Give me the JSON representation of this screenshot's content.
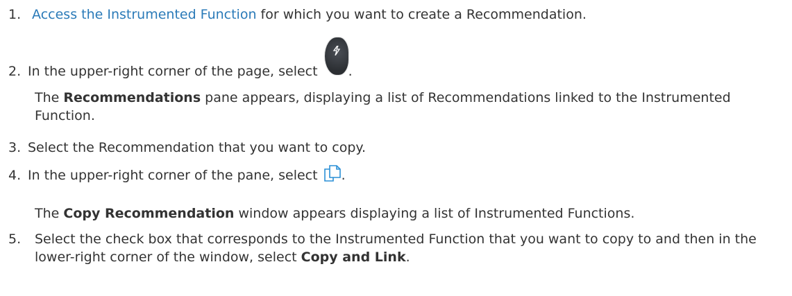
{
  "steps": [
    {
      "number": "1.",
      "link_text": "Access the Instrumented Function",
      "text_after_link": " for which you want to create a Recommendation."
    },
    {
      "number": "2.",
      "text": "In the upper-right corner of the page, select ",
      "icon": "recommendations-icon",
      "text_after_icon": ".",
      "result_pre": "The ",
      "result_bold": "Recommendations",
      "result_post": " pane appears, displaying a list of Recommendations linked to the Instrumented Function."
    },
    {
      "number": "3.",
      "text": "Select the Recommendation that you want to copy."
    },
    {
      "number": "4.",
      "text": "In the upper-right corner of the pane, select ",
      "icon": "copy-icon",
      "text_after_icon": ".",
      "result_pre": "The ",
      "result_bold": "Copy Recommendation",
      "result_post": " window appears displaying a list of Instrumented Functions."
    },
    {
      "number": "5.",
      "text": "Select the check box that corresponds to the Instrumented Function that you want to copy to and then in the lower-right corner of the window, select ",
      "bold": "Copy and Link",
      "text_after_bold": "."
    }
  ],
  "colors": {
    "link": "#2a7ab8",
    "text": "#333333"
  }
}
